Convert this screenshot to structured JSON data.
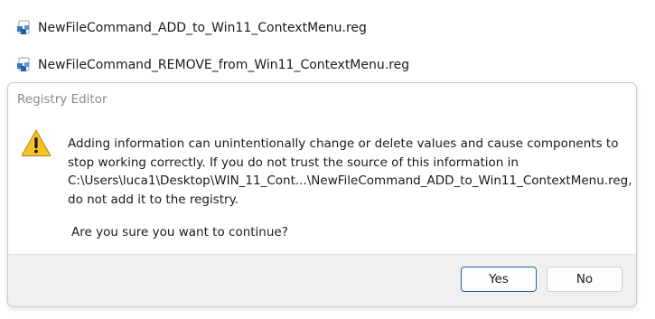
{
  "files": [
    {
      "name": "NewFileCommand_ADD_to_Win11_ContextMenu.reg",
      "icon": "registry-file-icon"
    },
    {
      "name": "NewFileCommand_REMOVE_from_Win11_ContextMenu.reg",
      "icon": "registry-file-icon"
    }
  ],
  "dialog": {
    "title": "Registry Editor",
    "icon": "warning-icon",
    "message_lines": [
      "Adding information can unintentionally change or delete values and cause components to",
      "stop working correctly. If you do not trust the source of this information in",
      "C:\\Users\\luca1\\Desktop\\WIN_11_Cont...\\NewFileCommand_ADD_to_Win11_ContextMenu.reg,",
      "do not add it to the registry."
    ],
    "question": "Are you sure you want to continue?",
    "buttons": {
      "yes": "Yes",
      "no": "No"
    }
  },
  "colors": {
    "primary_border": "#1f5f9a",
    "footer_bg": "#f0f0f0",
    "warning_yellow": "#f5c22b"
  }
}
